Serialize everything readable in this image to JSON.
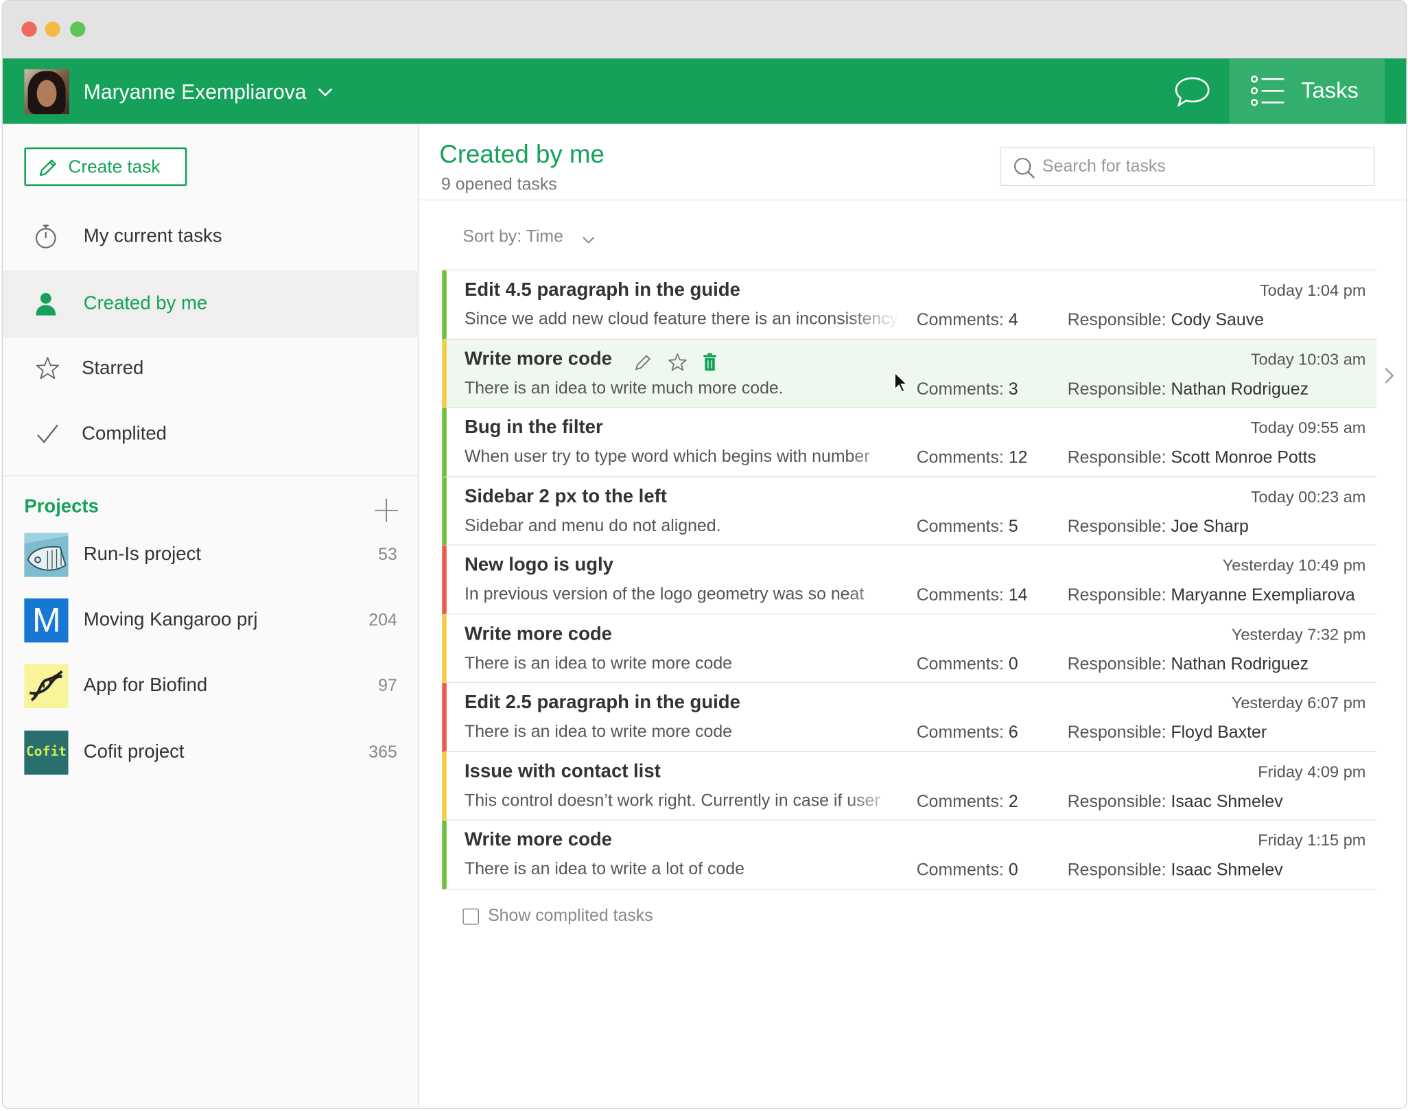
{
  "user": {
    "name": "Maryanne Exempliarova"
  },
  "topbar": {
    "chat_icon": "chat-bubble-icon",
    "tasks_icon": "list-icon",
    "tasks_label": "Tasks"
  },
  "sidebar": {
    "create_label": "Create task",
    "nav": [
      {
        "label": "My current tasks",
        "icon": "stopwatch-icon",
        "active": false
      },
      {
        "label": "Created by me",
        "icon": "person-icon",
        "active": true
      },
      {
        "label": "Starred",
        "icon": "star-icon",
        "active": false
      },
      {
        "label": "Complited",
        "icon": "checkmark-icon",
        "active": false
      }
    ],
    "projects_title": "Projects",
    "projects": [
      {
        "name": "Run-Is project",
        "count": "53"
      },
      {
        "name": "Moving Kangaroo prj",
        "count": "204",
        "thumb_letter": "M"
      },
      {
        "name": "App for Biofind",
        "count": "97"
      },
      {
        "name": "Cofit project",
        "count": "365",
        "thumb_text": "Cofit"
      }
    ]
  },
  "main": {
    "title": "Created by me",
    "subtitle": "9 opened tasks",
    "search_placeholder": "Search for tasks",
    "sort_label": "Sort by: Time",
    "show_completed_label": "Show complited tasks",
    "comments_label": "Comments:",
    "responsible_label": "Responsible:",
    "colors": {
      "accent": "#16a15a",
      "green": "#6cc23a",
      "yellow": "#f6cb45",
      "red": "#ed5a50"
    }
  },
  "tasks": [
    {
      "title": "Edit 4.5 paragraph in the guide",
      "time": "Today 1:04 pm",
      "desc": "Since we add new cloud feature there is an inconsistency",
      "comments": "4",
      "responsible": "Cody Sauve",
      "priority": "green"
    },
    {
      "title": "Write more code",
      "time": "Today 10:03 am",
      "desc": "There is an idea to write much more code.",
      "comments": "3",
      "responsible": "Nathan Rodriguez",
      "priority": "yellow",
      "hover": true
    },
    {
      "title": "Bug in the filter",
      "time": "Today 09:55 am",
      "desc": "When user try to type word which begins with number",
      "comments": "12",
      "responsible": "Scott Monroe Potts",
      "priority": "green"
    },
    {
      "title": "Sidebar 2 px to the left",
      "time": "Today 00:23 am",
      "desc": "Sidebar and menu do not aligned.",
      "comments": "5",
      "responsible": "Joe Sharp",
      "priority": "green"
    },
    {
      "title": "New logo is ugly",
      "time": "Yesterday 10:49 pm",
      "desc": "In previous version of the logo geometry was so neat",
      "comments": "14",
      "responsible": "Maryanne Exempliarova",
      "priority": "red"
    },
    {
      "title": "Write more code",
      "time": "Yesterday 7:32 pm",
      "desc": "There is an idea to write more code",
      "comments": "0",
      "responsible": "Nathan Rodriguez",
      "priority": "yellow"
    },
    {
      "title": "Edit 2.5 paragraph in the guide",
      "time": "Yesterday 6:07 pm",
      "desc": "There is an idea to write more code",
      "comments": "6",
      "responsible": "Floyd Baxter",
      "priority": "red"
    },
    {
      "title": "Issue with contact list",
      "time": "Friday 4:09 pm",
      "desc": "This control doesn’t work right. Currently in case if user",
      "comments": "2",
      "responsible": "Isaac Shmelev",
      "priority": "yellow"
    },
    {
      "title": "Write more code",
      "time": "Friday 1:15 pm",
      "desc": "There is an idea to write a lot of code",
      "comments": "0",
      "responsible": "Isaac Shmelev",
      "priority": "green"
    }
  ]
}
